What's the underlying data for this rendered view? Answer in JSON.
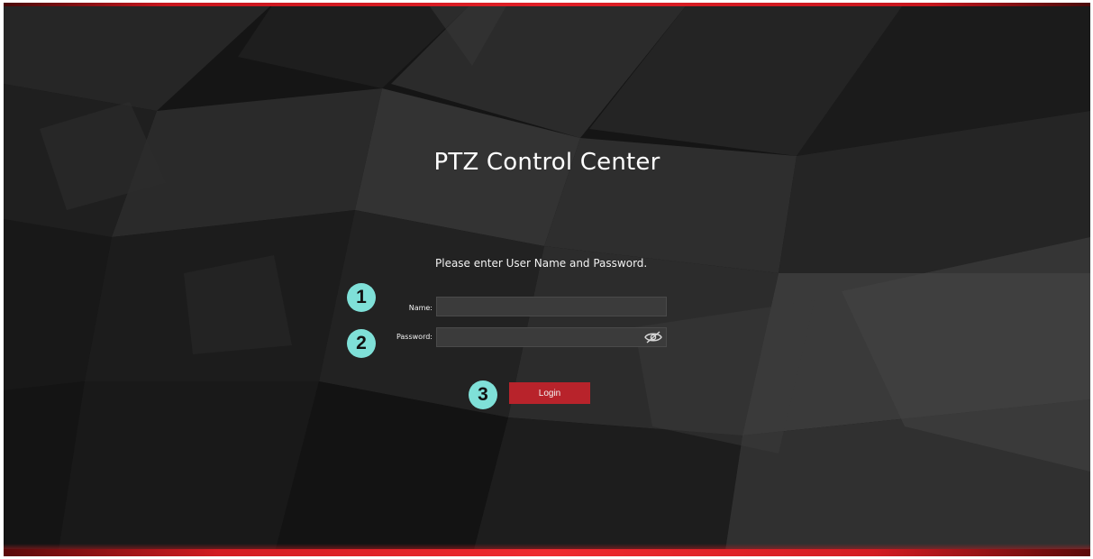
{
  "app": {
    "title": "PTZ Control Center",
    "prompt": "Please enter User Name and Password."
  },
  "form": {
    "name_label": "Name:",
    "name_value": "",
    "password_label": "Password:",
    "password_value": "",
    "login_label": "Login",
    "show_password_icon": "eye-slash-icon"
  },
  "annotations": {
    "badge_1": "1",
    "badge_2": "2",
    "badge_3": "3"
  },
  "colors": {
    "accent_red": "#e01f26",
    "button_red": "#b8232b",
    "badge_teal": "#7fe0d8",
    "background_dark": "#111111"
  }
}
